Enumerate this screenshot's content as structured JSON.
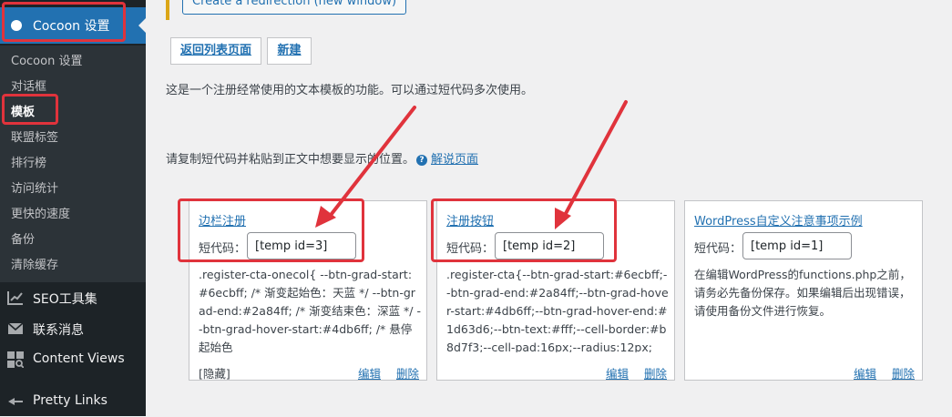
{
  "sidebar": {
    "active": {
      "label": "Cocoon 设置",
      "icon": "cocoon-icon"
    },
    "submenu": [
      {
        "label": "Cocoon 设置"
      },
      {
        "label": "对话框"
      },
      {
        "label": "模板",
        "current": true
      },
      {
        "label": "联盟标签"
      },
      {
        "label": "排行榜"
      },
      {
        "label": "访问统计"
      },
      {
        "label": "更快的速度"
      },
      {
        "label": "备份"
      },
      {
        "label": "清除缓存"
      }
    ],
    "menu": [
      {
        "label": "SEO工具集",
        "icon": "chart-icon"
      },
      {
        "label": "联系消息",
        "icon": "mail-icon"
      },
      {
        "label": "Content Views",
        "icon": "grid-icon"
      },
      {
        "label": "Pretty Links",
        "icon": "star-icon"
      }
    ]
  },
  "main": {
    "redirect_button": "Create a redirection (new window)",
    "back_button": "返回列表页面",
    "new_button": "新建",
    "description": "这是一个注册经常使用的文本模板的功能。可以通过短代码多次使用。",
    "copy_hint": "请复制短代码并粘贴到正文中想要显示的位置。",
    "help_icon": "question-icon",
    "help_link": "解说页面",
    "shortcode_label": "短代码：",
    "edit_label": "编辑",
    "delete_label": "删除",
    "cards": [
      {
        "title": "边栏注册",
        "shortcode": "[temp id=3]",
        "body": ".register-cta-onecol{ --btn-grad-start:#6ecbff; /* 渐变起始色：天蓝 */ --btn-grad-end:#2a84ff; /* 渐变结束色：深蓝 */ --btn-grad-hover-start:#4db6ff; /* 悬停起始色",
        "hidden": "[隐藏]"
      },
      {
        "title": "注册按钮",
        "shortcode": "[temp id=2]",
        "body": ".register-cta{--btn-grad-start:#6ecbff;--btn-grad-end:#2a84ff;--btn-grad-hover-start:#4db6ff;--btn-grad-hover-end:#1d63d6;--btn-text:#fff;--cell-border:#b8d7f3;--cell-pad:16px;--radius:12px;",
        "hidden": ""
      },
      {
        "title": "WordPress自定义注意事项示例",
        "shortcode": "[temp id=1]",
        "body": "在编辑WordPress的functions.php之前，请务必先备份保存。如果编辑后出现错误，请使用备份文件进行恢复。",
        "hidden": ""
      }
    ]
  },
  "colors": {
    "sidebar_bg": "#1d2327",
    "accent": "#2271b1",
    "annotation_red": "#e0333c"
  }
}
